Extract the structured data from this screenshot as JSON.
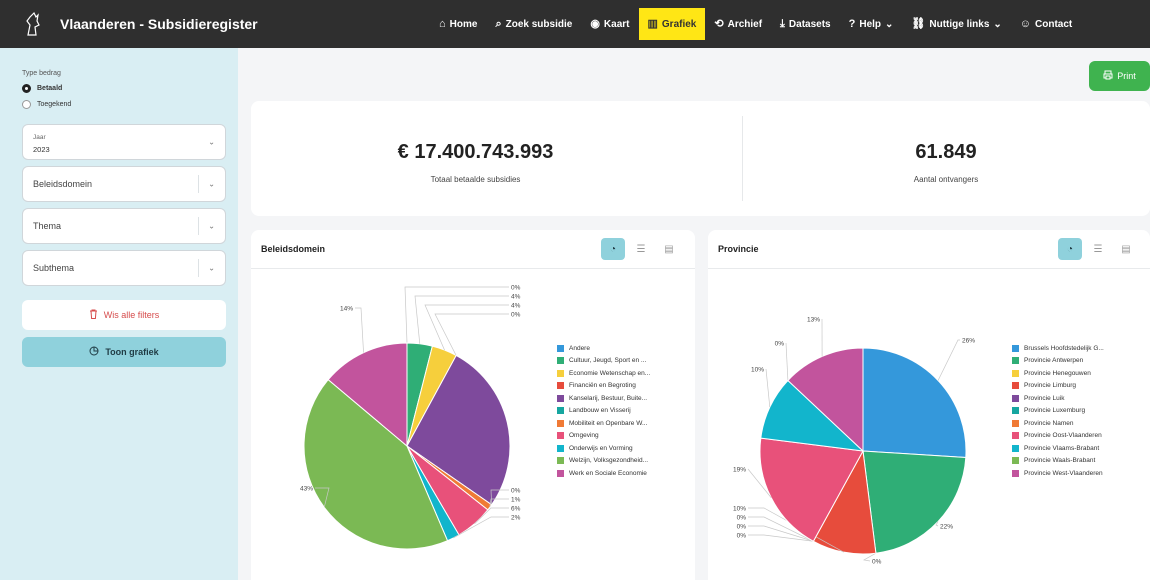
{
  "header": {
    "title": "Vlaanderen - Subsidieregister",
    "nav": [
      {
        "label": "Home",
        "icon": "home-icon",
        "glyph": "⌂"
      },
      {
        "label": "Zoek subsidie",
        "icon": "search-icon",
        "glyph": "⌕"
      },
      {
        "label": "Kaart",
        "icon": "map-pin-icon",
        "glyph": "◉"
      },
      {
        "label": "Grafiek",
        "icon": "bar-chart-icon",
        "glyph": "▥",
        "active": true
      },
      {
        "label": "Archief",
        "icon": "history-icon",
        "glyph": "⟲"
      },
      {
        "label": "Datasets",
        "icon": "download-icon",
        "glyph": "⤓"
      },
      {
        "label": "Help",
        "icon": "help-icon",
        "glyph": "?",
        "chevron": "⌄"
      },
      {
        "label": "Nuttige links",
        "icon": "link-icon",
        "glyph": "⛓",
        "chevron": "⌄"
      },
      {
        "label": "Contact",
        "icon": "user-icon",
        "glyph": "☺"
      }
    ]
  },
  "sidebar": {
    "type_label": "Type bedrag",
    "radio_paid": "Betaald",
    "radio_granted": "Toegekend",
    "year_label": "Jaar",
    "year_value": "2023",
    "domain_placeholder": "Beleidsdomein",
    "theme_placeholder": "Thema",
    "subtheme_placeholder": "Subthema",
    "clear_label": "Wis alle filters",
    "show_label": "Toon grafiek"
  },
  "toolbar": {
    "print_label": "Print"
  },
  "stats": {
    "total_value": "€ 17.400.743.993",
    "total_label": "Totaal betaalde subsidies",
    "recipients_value": "61.849",
    "recipients_label": "Aantal ontvangers"
  },
  "chart_data": [
    {
      "type": "pie",
      "title": "Beleidsdomein",
      "labels": [
        "Andere",
        "Cultuur, Jeugd, Sport en ...",
        "Economie Wetenschap en...",
        "Financiën en Begroting",
        "Kanselarij, Bestuur, Buite...",
        "Landbouw en Visserij",
        "Mobiliteit en Openbare W...",
        "Omgeving",
        "Onderwijs en Vorming",
        "Welzijn, Volksgezondheid...",
        "Werk en Sociale Economie"
      ],
      "values": [
        0,
        4,
        4,
        0,
        27,
        0,
        1,
        6,
        2,
        43,
        14
      ],
      "label_texts": [
        "0%",
        "4%",
        "4%",
        "0%",
        "",
        "0%",
        "1%",
        "6%",
        "2%",
        "43%",
        "14%"
      ],
      "colors": [
        "#3498db",
        "#2fae76",
        "#f6cf3c",
        "#e74c3c",
        "#7e4a9c",
        "#16a6a0",
        "#f07a35",
        "#e8517a",
        "#12b5cc",
        "#7bb954",
        "#c2549d"
      ]
    },
    {
      "type": "pie",
      "title": "Provincie",
      "labels": [
        "Brussels Hoofdstedelijk G...",
        "Provincie Antwerpen",
        "Provincie Henegouwen",
        "Provincie Limburg",
        "Provincie Luik",
        "Provincie Luxemburg",
        "Provincie Namen",
        "Provincie Oost-Vlaanderen",
        "Provincie Vlaams-Brabant",
        "Provincie Waals-Brabant",
        "Provincie West-Vlaanderen"
      ],
      "values": [
        26,
        22,
        0,
        10,
        0,
        0,
        0,
        19,
        10,
        0,
        13
      ],
      "label_texts": [
        "26%",
        "22%",
        "0%",
        "10%",
        "0%",
        "0%",
        "0%",
        "19%",
        "10%",
        "0%",
        "13%"
      ],
      "colors": [
        "#3498db",
        "#2fae76",
        "#f6cf3c",
        "#e74c3c",
        "#7e4a9c",
        "#16a6a0",
        "#f07a35",
        "#e8517a",
        "#12b5cc",
        "#7bb954",
        "#c2549d"
      ]
    }
  ]
}
